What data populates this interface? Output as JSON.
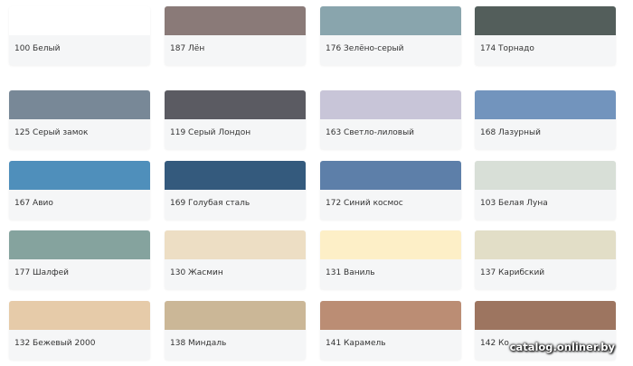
{
  "colors": {
    "c100": {
      "label": "100 Белый",
      "hex": "#ffffff"
    },
    "c187": {
      "label": "187 Лён",
      "hex": "#8a7a78"
    },
    "c176": {
      "label": "176 Зелёно-серый",
      "hex": "#89a5ad"
    },
    "c174": {
      "label": "174 Торнадо",
      "hex": "#535e5b"
    },
    "c125": {
      "label": "125 Серый замок",
      "hex": "#788897"
    },
    "c119": {
      "label": "119 Серый Лондон",
      "hex": "#5b5b62"
    },
    "c163": {
      "label": "163 Светло-лиловый",
      "hex": "#c8c5d8"
    },
    "c168": {
      "label": "168 Лазурный",
      "hex": "#7294bd"
    },
    "c167": {
      "label": "167 Авио",
      "hex": "#4f8fbb"
    },
    "c169": {
      "label": "169 Голубая сталь",
      "hex": "#345a7d"
    },
    "c172": {
      "label": "172 Синий космос",
      "hex": "#5d7fa9"
    },
    "c103": {
      "label": "103 Белая Луна",
      "hex": "#d8dfd7"
    },
    "c177": {
      "label": "177 Шалфей",
      "hex": "#85a39e"
    },
    "c130": {
      "label": "130 Жасмин",
      "hex": "#eddec4"
    },
    "c131": {
      "label": "131 Ваниль",
      "hex": "#fdefc7"
    },
    "c137": {
      "label": "137 Карибский",
      "hex": "#e2dec7"
    },
    "c132": {
      "label": "132 Бежевый 2000",
      "hex": "#e6cba9"
    },
    "c138": {
      "label": "138 Миндаль",
      "hex": "#cbb797"
    },
    "c141": {
      "label": "141 Карамель",
      "hex": "#bb8d74"
    },
    "c142": {
      "label": "142 Ко",
      "hex": "#9d7560"
    }
  },
  "watermark": "catalog.onliner.by"
}
